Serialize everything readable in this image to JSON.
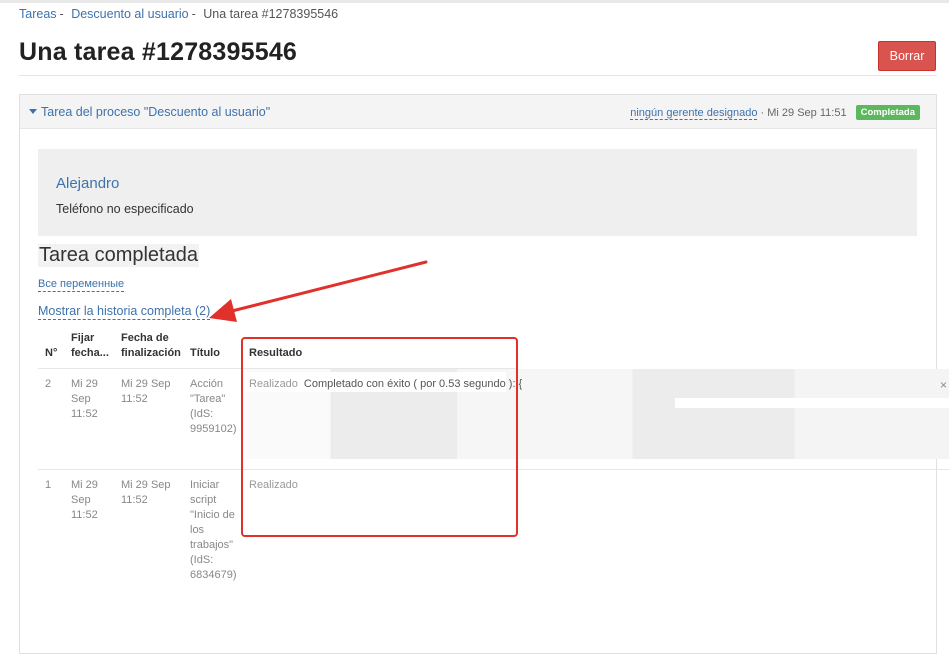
{
  "breadcrumb": {
    "items": [
      "Tareas",
      "Descuento al usuario"
    ],
    "current": "Una tarea #1278395546",
    "separator": "-"
  },
  "page": {
    "title": "Una tarea #1278395546",
    "delete_label": "Borrar"
  },
  "panel": {
    "toggle_label": "Tarea del proceso \"Descuento al usuario\"",
    "manager": "ningún gerente designado",
    "date": "· Mi 29 Sep 11:51",
    "status": "Completada",
    "status_color": "#5cb85c"
  },
  "client": {
    "name": "Alejandro",
    "phone": "Teléfono no especificado"
  },
  "task": {
    "heading": "Tarea completada",
    "vars_link": "Все переменные",
    "history_link": "Mostrar la historia completa (2)"
  },
  "table": {
    "headers": {
      "num": "N°",
      "fix_date": "Fijar fecha...",
      "end_date_1": "Fecha de",
      "end_date_2": "finalización",
      "title": "Título",
      "result": "Resultado"
    },
    "rows": [
      {
        "num": "2",
        "fix_date": [
          "Mi 29",
          "Sep",
          "11:52"
        ],
        "end_date": [
          "Mi 29 Sep",
          "11:52"
        ],
        "title": [
          "Acción",
          "\"Tarea\"",
          "(IdS:",
          "9959102)"
        ],
        "result_label": "Realizado",
        "result_text": "Completado con éxito ( por 0.53 segundo ): {"
      },
      {
        "num": "1",
        "fix_date": [
          "Mi 29",
          "Sep",
          "11:52"
        ],
        "end_date": [
          "Mi 29 Sep",
          "11:52"
        ],
        "title": [
          "Iniciar",
          "script",
          "\"Inicio de",
          "los",
          "trabajos\"",
          "(IdS:",
          "6834679)"
        ],
        "result_label": "Realizado",
        "result_text": ""
      }
    ]
  },
  "annotation": {
    "color": "#e0312b"
  }
}
